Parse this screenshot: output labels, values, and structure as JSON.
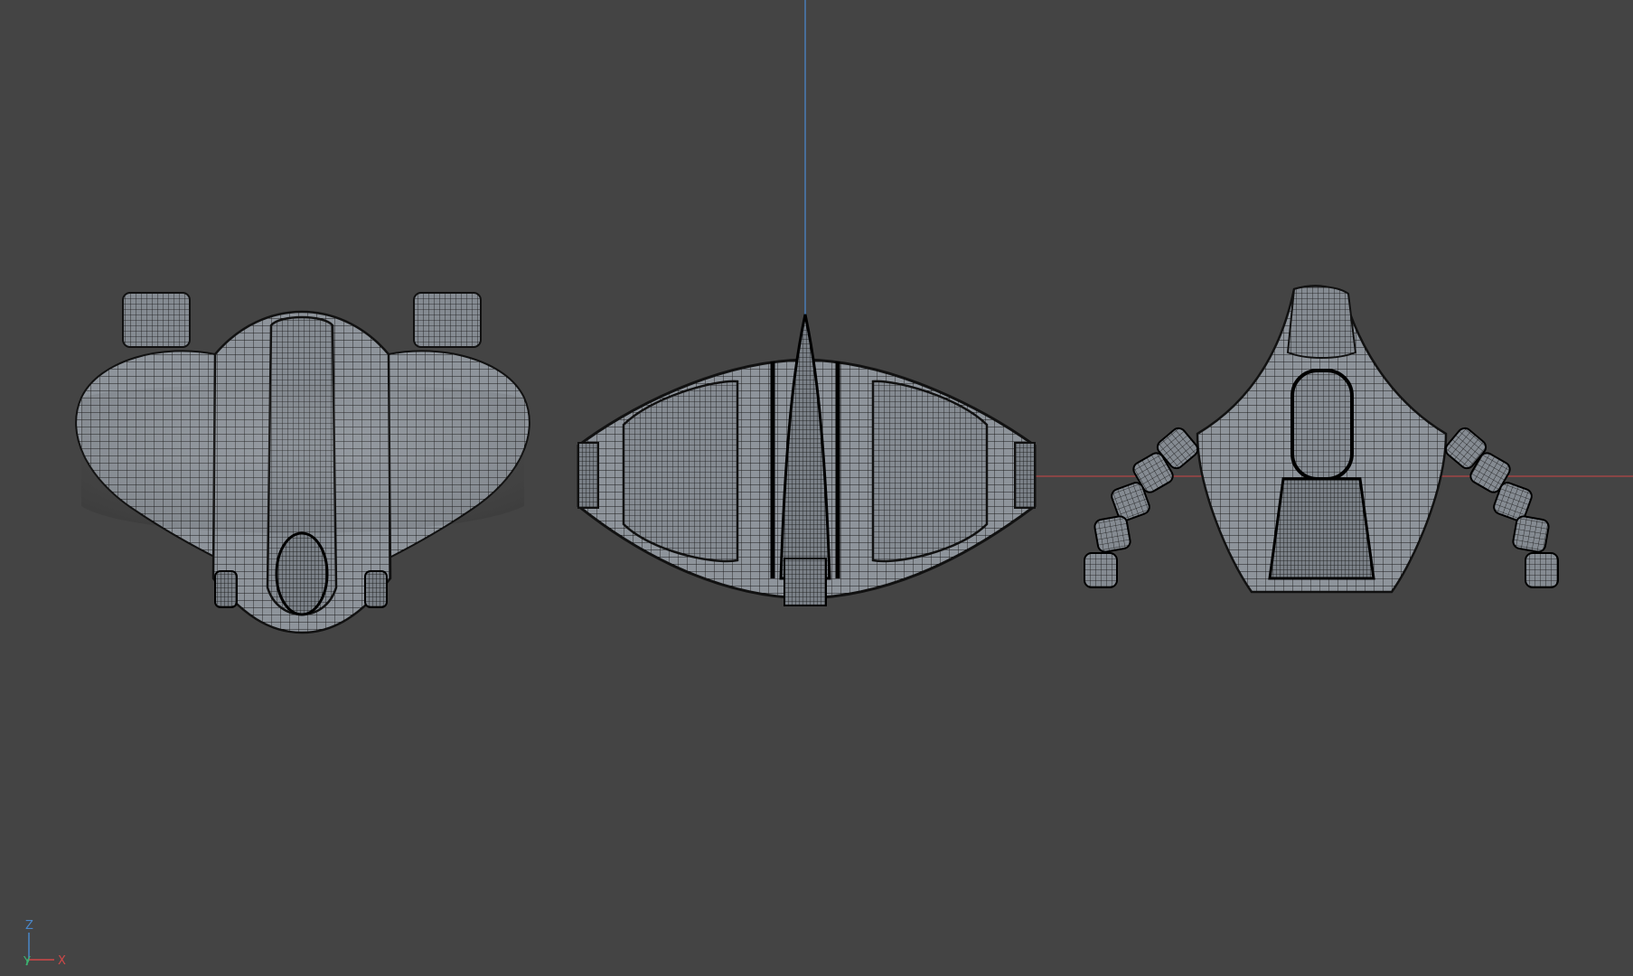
{
  "viewport": {
    "background": "#444444",
    "axis_line_colors": {
      "vertical": "#4a86c8",
      "horizontal": "#b04646"
    },
    "wireframe": {
      "fill": "#8e949b",
      "wire": "#1a1a1a"
    },
    "views": [
      {
        "name": "front-view-model"
      },
      {
        "name": "top-view-model"
      },
      {
        "name": "side-view-model"
      }
    ]
  },
  "axis_gizmo": {
    "z_label": "Z",
    "y_label": "Y",
    "x_label": "X",
    "z_color": "#4a86c8",
    "y_color": "#3cb371",
    "x_color": "#d04848"
  }
}
